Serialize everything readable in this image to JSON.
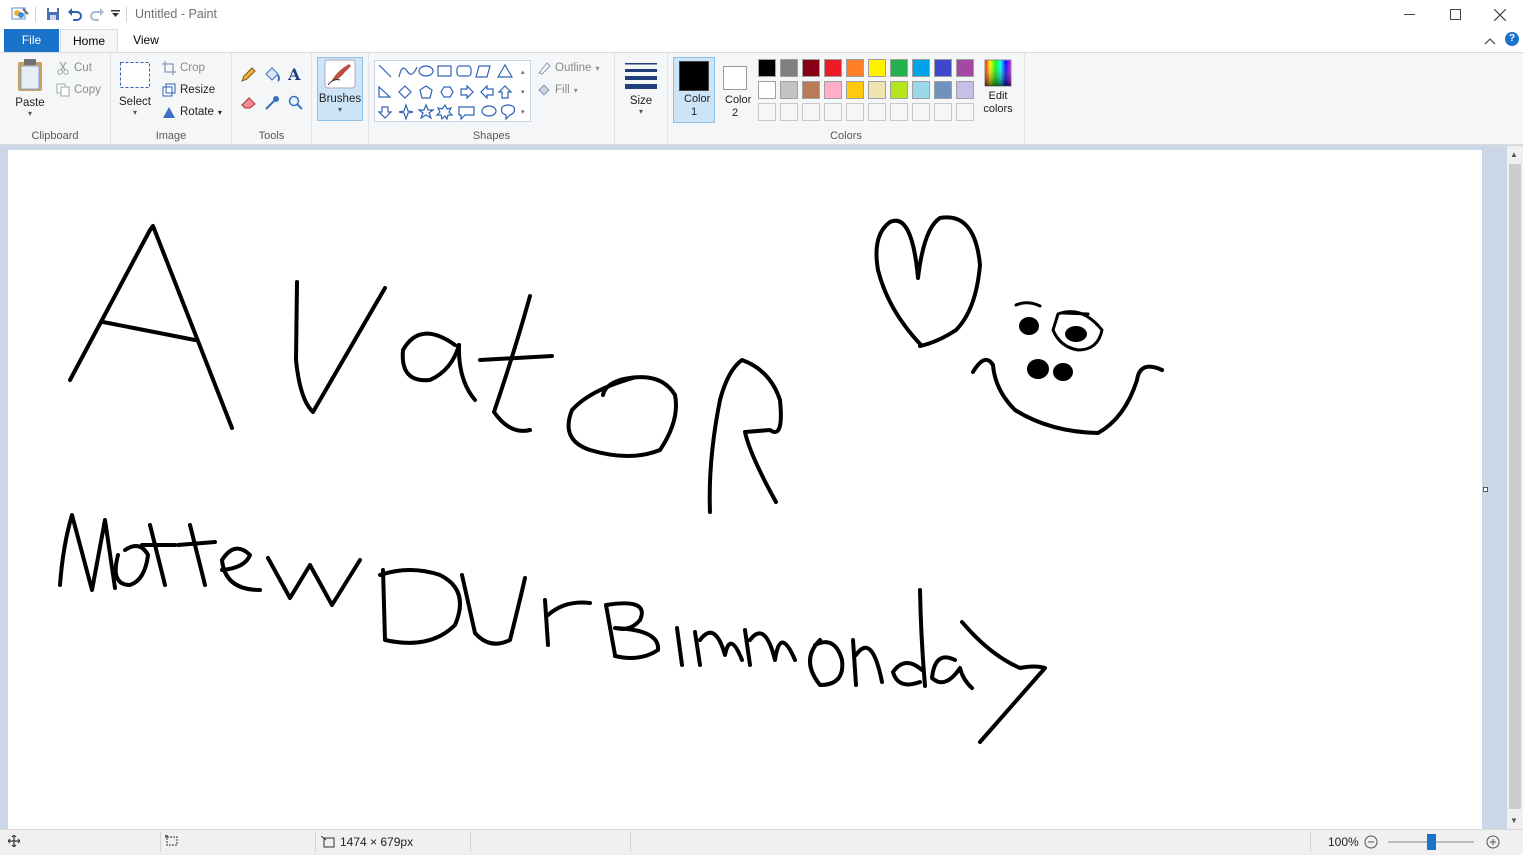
{
  "window": {
    "title": "Untitled - Paint"
  },
  "tabs": {
    "file": "File",
    "home": "Home",
    "view": "View"
  },
  "ribbon": {
    "clipboard": {
      "paste": "Paste",
      "cut": "Cut",
      "copy": "Copy",
      "label": "Clipboard"
    },
    "image": {
      "select": "Select",
      "crop": "Crop",
      "resize": "Resize",
      "rotate": "Rotate",
      "label": "Image"
    },
    "tools": {
      "label": "Tools",
      "icons": [
        "pencil-icon",
        "fill-bucket-icon",
        "text-icon",
        "eraser-icon",
        "color-picker-icon",
        "magnifier-icon"
      ]
    },
    "brushes": {
      "label": "Brushes"
    },
    "shapes": {
      "outline": "Outline",
      "fill": "Fill",
      "label": "Shapes"
    },
    "size": {
      "label": "Size"
    },
    "colors": {
      "color1": "Color 1",
      "color2": "Color 2",
      "edit": "Edit colors",
      "label": "Colors",
      "color1_value": "#000000",
      "color2_value": "#ffffff",
      "row1": [
        "#000000",
        "#7f7f7f",
        "#880015",
        "#ed1c24",
        "#ff7f27",
        "#fff200",
        "#22b14c",
        "#00a2e8",
        "#3f48cc",
        "#a349a4"
      ],
      "row2": [
        "#ffffff",
        "#c3c3c3",
        "#b97a57",
        "#ffaec9",
        "#ffc90e",
        "#efe4b0",
        "#b5e61d",
        "#99d9ea",
        "#7092be",
        "#c8bfe7"
      ]
    }
  },
  "status": {
    "dimensions": "1474 × 679px",
    "zoom": "100%"
  }
}
